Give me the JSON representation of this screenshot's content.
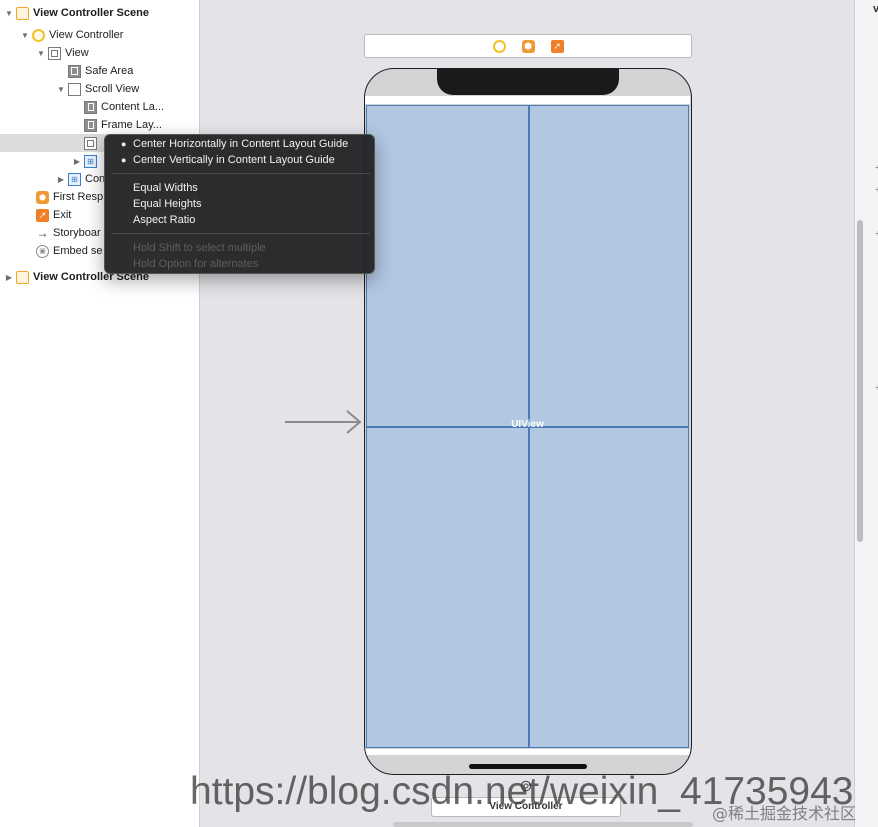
{
  "outline": {
    "items": [
      {
        "label": "View Controller Scene",
        "expanded": true,
        "icon": "scene-icon"
      },
      {
        "label": "View Controller",
        "expanded": true,
        "icon": "view-controller-icon"
      },
      {
        "label": "View",
        "expanded": true,
        "icon": "view-icon"
      },
      {
        "label": "Safe Area",
        "icon": "layout-guide-icon"
      },
      {
        "label": "Scroll View",
        "expanded": true,
        "icon": "scroll-view-icon"
      },
      {
        "label": "Content La...",
        "icon": "layout-guide-icon"
      },
      {
        "label": "Frame Lay...",
        "icon": "layout-guide-icon"
      },
      {
        "label": "",
        "icon": "view-icon",
        "selected": true
      },
      {
        "label": "",
        "collapsed": true,
        "icon": "constraints-icon"
      },
      {
        "label": "Con",
        "collapsed": true,
        "icon": "constraints-icon"
      },
      {
        "label": "First Resp",
        "icon": "first-responder-icon"
      },
      {
        "label": "Exit",
        "icon": "exit-icon"
      },
      {
        "label": "Storyboar",
        "icon": "storyboard-entry-arrow-icon"
      },
      {
        "label": "Embed se",
        "icon": "embed-segue-icon"
      },
      {
        "label": "View Controller Scene",
        "collapsed": true,
        "icon": "scene-icon"
      }
    ]
  },
  "menu": {
    "items": [
      {
        "label": "Center Horizontally in Content Layout Guide",
        "bullet": true
      },
      {
        "label": "Center Vertically in Content Layout Guide",
        "bullet": true
      },
      {
        "label": "Equal Widths"
      },
      {
        "label": "Equal Heights"
      },
      {
        "label": "Aspect Ratio"
      },
      {
        "label": "Hold Shift to select multiple",
        "disabled": true
      },
      {
        "label": "Hold Option for alternates",
        "disabled": true
      }
    ]
  },
  "canvas": {
    "content_label": "UIView",
    "scene_label": "View Controller",
    "content_color": "#b1c7e2",
    "accent_color": "#4a7bb6"
  },
  "right_strip": {
    "letter": "v"
  },
  "watermark": {
    "url": "https://blog.csdn.net/weixin_41735943",
    "brand": "@稀土掘金技术社区"
  }
}
